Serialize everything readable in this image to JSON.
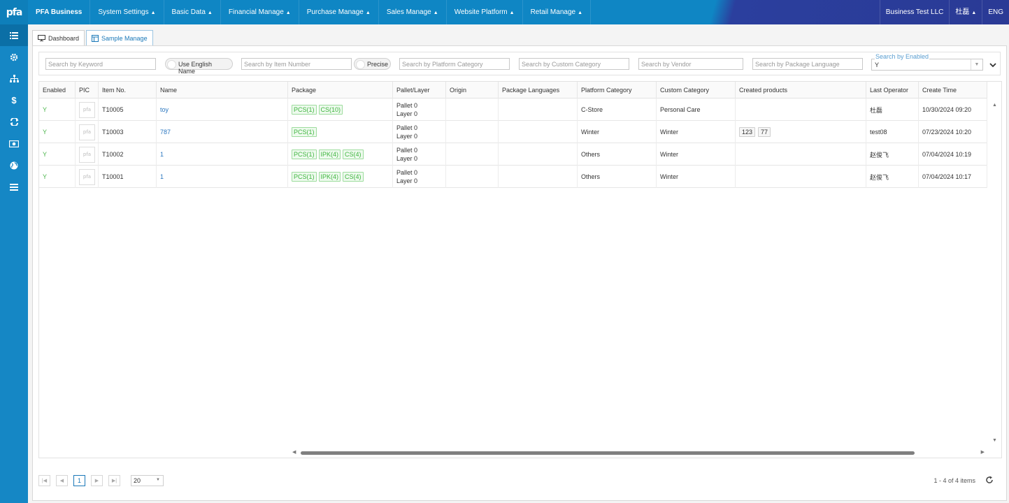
{
  "topbar": {
    "logo": "pfa",
    "brand": "PFA Business",
    "menus": [
      "System Settings",
      "Basic Data",
      "Financial Manage",
      "Purchase Manage",
      "Sales Manage",
      "Website Platform",
      "Retail Manage"
    ],
    "company": "Business Test LLC",
    "user": "杜磊",
    "language": "ENG",
    "accent_color": "#0f86c4"
  },
  "sidebar": {
    "icons": [
      "list-icon",
      "gear-icon",
      "org-chart-icon",
      "dollar-icon",
      "exchange-icon",
      "money-icon",
      "globe-icon",
      "menu-icon"
    ]
  },
  "tabs": [
    {
      "label": "Dashboard",
      "icon": "monitor-icon"
    },
    {
      "label": "Sample Manage",
      "icon": "layout-icon"
    }
  ],
  "filters": {
    "keyword_placeholder": "Search by Keyword",
    "use_english_label": "Use English Name",
    "item_number_placeholder": "Search by Item Number",
    "precise_label": "Precise",
    "platform_category_placeholder": "Search by Platform Category",
    "custom_category_placeholder": "Search by Custom Category",
    "vendor_placeholder": "Search by Vendor",
    "package_language_placeholder": "Search by Package Language",
    "enabled_label": "Search by Enabled",
    "enabled_value": "Y"
  },
  "grid": {
    "columns": [
      "Enabled",
      "PIC",
      "Item No.",
      "Name",
      "Package",
      "Pallet/Layer",
      "Origin",
      "Package Languages",
      "Platform Category",
      "Custom Category",
      "Created products",
      "Last Operator",
      "Create Time"
    ],
    "rows": [
      {
        "enabled": "Y",
        "pic": "pfa",
        "item_no": "T10005",
        "name": "toy",
        "packages": [
          "PCS(1)",
          "CS(10)"
        ],
        "pallet": "Pallet 0",
        "layer": "Layer 0",
        "origin": "",
        "package_languages": "",
        "platform_category": "C-Store",
        "custom_category": "Personal Care",
        "created_products": [],
        "last_operator": "杜磊",
        "create_time": "10/30/2024 09:20"
      },
      {
        "enabled": "Y",
        "pic": "pfa",
        "item_no": "T10003",
        "name": "787",
        "packages": [
          "PCS(1)"
        ],
        "pallet": "Pallet 0",
        "layer": "Layer 0",
        "origin": "",
        "package_languages": "",
        "platform_category": "Winter",
        "custom_category": "Winter",
        "created_products": [
          "123",
          "77"
        ],
        "last_operator": "test08",
        "create_time": "07/23/2024 10:20"
      },
      {
        "enabled": "Y",
        "pic": "pfa",
        "item_no": "T10002",
        "name": "1",
        "packages": [
          "PCS(1)",
          "IPK(4)",
          "CS(4)"
        ],
        "pallet": "Pallet 0",
        "layer": "Layer 0",
        "origin": "",
        "package_languages": "",
        "platform_category": "Others",
        "custom_category": "Winter",
        "created_products": [],
        "last_operator": "赵俊飞",
        "create_time": "07/04/2024 10:19"
      },
      {
        "enabled": "Y",
        "pic": "pfa",
        "item_no": "T10001",
        "name": "1",
        "packages": [
          "PCS(1)",
          "IPK(4)",
          "CS(4)"
        ],
        "pallet": "Pallet 0",
        "layer": "Layer 0",
        "origin": "",
        "package_languages": "",
        "platform_category": "Others",
        "custom_category": "Winter",
        "created_products": [],
        "last_operator": "赵俊飞",
        "create_time": "07/04/2024 10:17"
      }
    ]
  },
  "pager": {
    "current_page": "1",
    "page_size": "20",
    "info": "1 - 4 of 4 items"
  }
}
